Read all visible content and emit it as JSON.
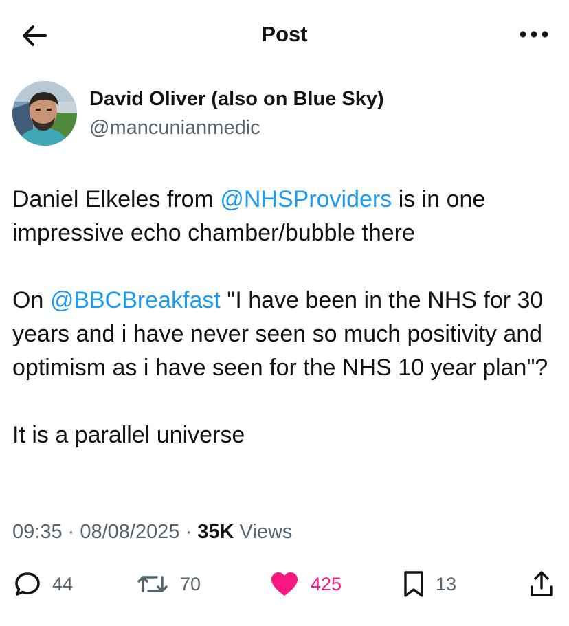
{
  "header": {
    "title": "Post"
  },
  "author": {
    "display_name": "David Oliver (also on Blue Sky)",
    "handle": "@mancunianmedic"
  },
  "post": {
    "p1_before": "Daniel Elkeles from ",
    "p1_mention": "@NHSProviders",
    "p1_after": " is in one impressive echo chamber/bubble there",
    "p2_before": "On ",
    "p2_mention": "@BBCBreakfast",
    "p2_after": " \"I have been in the NHS for 30 years and i have never seen so much positivity and optimism as i have seen for the NHS 10 year plan\"?",
    "p3": "It is a parallel universe"
  },
  "meta": {
    "time": "09:35",
    "separator": " · ",
    "date": "08/08/2025",
    "views_count": "35K",
    "views_label": " Views"
  },
  "actions": {
    "replies": "44",
    "reposts": "70",
    "likes": "425",
    "bookmarks": "13"
  },
  "icons": {
    "back": "arrow-left-icon",
    "more": "more-horizontal-icon",
    "reply": "speech-bubble-icon",
    "repost": "repost-icon",
    "like": "heart-icon",
    "bookmark": "bookmark-icon",
    "share": "share-icon"
  },
  "colors": {
    "mention": "#1d9bf0",
    "like": "#f91880",
    "secondary_text": "#536471",
    "primary_text": "#0f1419"
  }
}
